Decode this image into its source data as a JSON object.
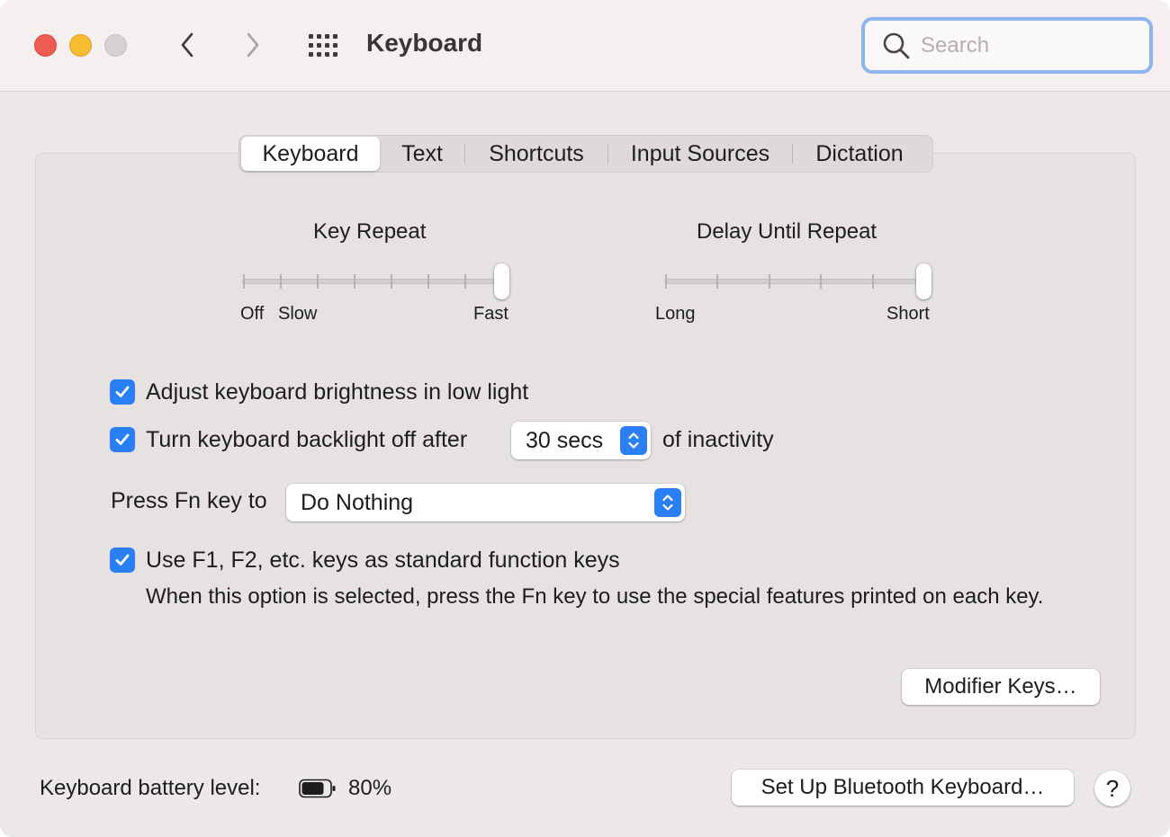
{
  "window": {
    "title": "Keyboard",
    "search_placeholder": "Search"
  },
  "tabs": [
    {
      "label": "Keyboard",
      "active": true
    },
    {
      "label": "Text",
      "active": false
    },
    {
      "label": "Shortcuts",
      "active": false
    },
    {
      "label": "Input Sources",
      "active": false
    },
    {
      "label": "Dictation",
      "active": false
    }
  ],
  "key_repeat": {
    "title": "Key Repeat",
    "labels": [
      "Off",
      "Slow",
      "Fast"
    ],
    "tick_count": 8,
    "selected_tick": 7
  },
  "delay_until_repeat": {
    "title": "Delay Until Repeat",
    "labels": [
      "Long",
      "Short"
    ],
    "tick_count": 6,
    "selected_tick": 5
  },
  "options": {
    "brightness": {
      "label": "Adjust keyboard brightness in low light",
      "checked": true
    },
    "backlight": {
      "label": "Turn keyboard backlight off after",
      "value": "30 secs",
      "suffix": "of inactivity",
      "checked": true
    },
    "fn_key": {
      "label": "Press Fn key to",
      "value": "Do Nothing"
    },
    "function_keys": {
      "label": "Use F1, F2, etc. keys as standard function keys",
      "checked": true,
      "description": "When this option is selected, press the Fn key to use the special features printed on each key."
    }
  },
  "buttons": {
    "modifier_keys": "Modifier Keys…",
    "bluetooth": "Set Up Bluetooth Keyboard…",
    "help": "?"
  },
  "battery": {
    "label": "Keyboard battery level:",
    "level": "80%",
    "fraction": 0.8
  },
  "colors": {
    "accent": "#2a7ff6",
    "close": "#ee5b52",
    "minimize": "#f5bc2f"
  },
  "icons": {
    "back": "chevron-left-icon",
    "forward": "chevron-right-icon",
    "grid": "grid-icon",
    "search": "search-icon",
    "check": "checkmark-icon",
    "battery": "battery-icon"
  }
}
